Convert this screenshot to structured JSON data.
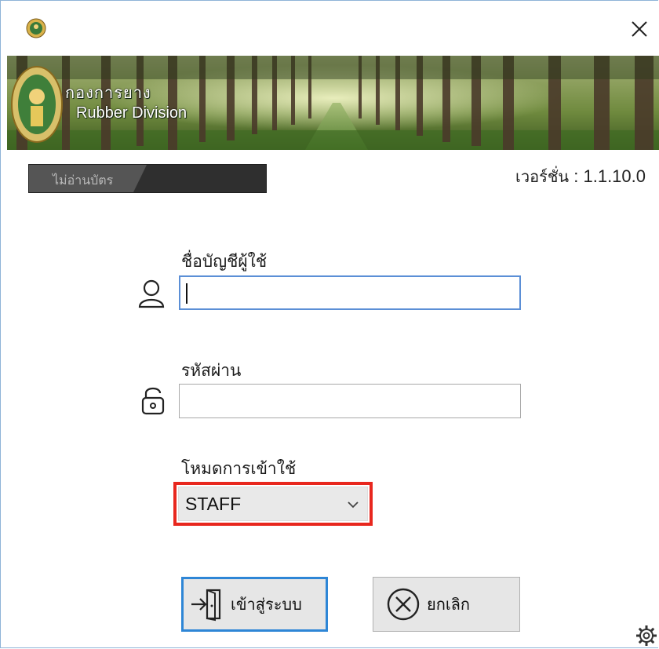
{
  "window": {
    "app_icon": "rubber-division-seal-icon",
    "close_icon": "close-icon"
  },
  "banner": {
    "logo_thai": "กองการยาง",
    "logo_en": "Rubber Division"
  },
  "card_reader": {
    "status": "ไม่อ่านบัตร"
  },
  "version": {
    "label": "เวอร์ชั่น",
    "separator": ":",
    "value": "1.1.10.0"
  },
  "form": {
    "username_label": "ชื่อบัญชีผู้ใช้",
    "username_value": "",
    "password_label": "รหัสผ่าน",
    "password_value": "",
    "mode_label": "โหมดการเข้าใช้",
    "mode_value": "STAFF"
  },
  "buttons": {
    "login_label": "เข้าสู่ระบบ",
    "cancel_label": "ยกเลิก"
  },
  "colors": {
    "highlight": "#e8271e",
    "focus_blue": "#2e86d6"
  }
}
